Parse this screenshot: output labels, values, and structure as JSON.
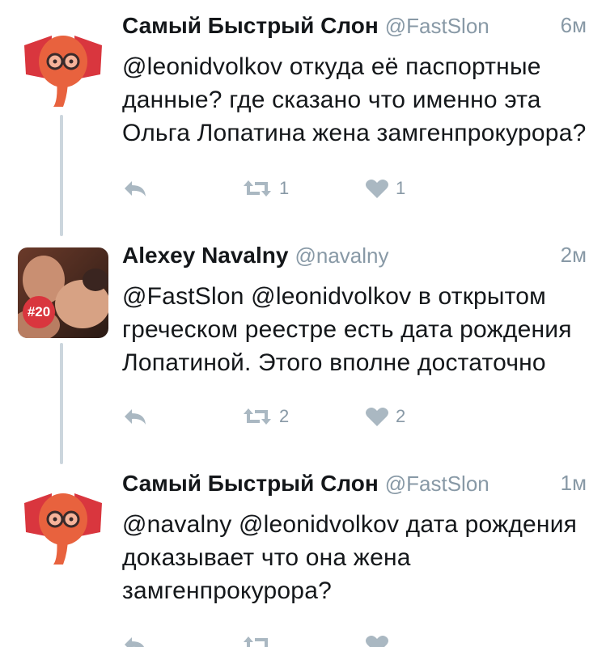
{
  "colors": {
    "accent_red": "#d9363e",
    "muted": "#8899a6",
    "icon": "#aab8c2",
    "thread_line": "#ccd6dd"
  },
  "tweets": [
    {
      "avatar_icon": "elephant-logo-icon",
      "name": "Самый Быстрый Слон",
      "handle": "@FastSlon",
      "time": "6м",
      "text": "@leonidvolkov откуда её паспортные данные? где сказано что именно эта Ольга Лопатина жена замгенпрокурора?",
      "retweets": "1",
      "likes": "1"
    },
    {
      "avatar_icon": "user-photo-avatar",
      "avatar_badge": "#20",
      "name": "Alexey Navalny",
      "handle": "@navalny",
      "time": "2м",
      "text": "@FastSlon @leonidvolkov в открытом греческом реестре есть дата рождения Лопатиной. Этого вполне достаточно",
      "retweets": "2",
      "likes": "2"
    },
    {
      "avatar_icon": "elephant-logo-icon",
      "name": "Самый Быстрый Слон",
      "handle": "@FastSlon",
      "time": "1м",
      "text": "@navalny @leonidvolkov дата рождения доказывает что она жена замгенпрокурора?",
      "retweets": "",
      "likes": ""
    }
  ]
}
